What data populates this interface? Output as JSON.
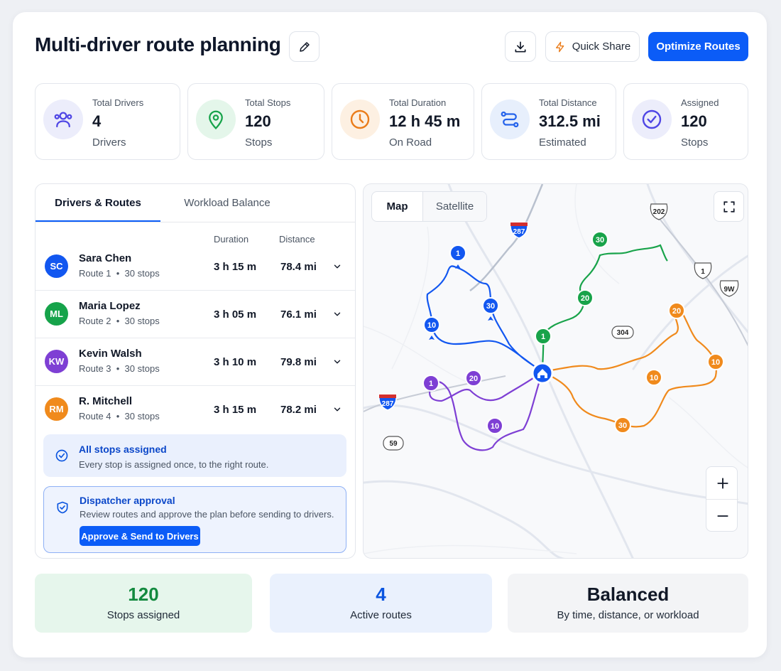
{
  "header": {
    "title": "Multi-driver route planning",
    "quick_share_label": "Quick Share",
    "optimize_label": "Optimize Routes"
  },
  "stats": [
    {
      "label": "Total Drivers",
      "value": "4",
      "sub": "Drivers",
      "icon": "drivers-icon",
      "color": "#4f46e5"
    },
    {
      "label": "Total Stops",
      "value": "120",
      "sub": "Stops",
      "icon": "map-pin-icon",
      "color": "#16a34a"
    },
    {
      "label": "Total Duration",
      "value": "12 h 45 m",
      "sub": "On Road",
      "icon": "clock-icon",
      "color": "#ea7c1a"
    },
    {
      "label": "Total Distance",
      "value": "312.5 mi",
      "sub": "Estimated",
      "icon": "route-icon",
      "color": "#2563eb"
    },
    {
      "label": "Assigned",
      "value": "120",
      "sub": "Stops",
      "icon": "check-circle-icon",
      "color": "#4f46e5"
    }
  ],
  "panel": {
    "tabs": [
      {
        "label": "Drivers & Routes",
        "active": true
      },
      {
        "label": "Workload Balance",
        "active": false
      }
    ],
    "columns": {
      "duration": "Duration",
      "distance": "Distance"
    },
    "drivers": [
      {
        "initials": "SC",
        "name": "Sara Chen",
        "route": "Route 1",
        "stops": "30 stops",
        "duration": "3 h 15 m",
        "distance": "78.4 mi",
        "color": "#1257f0"
      },
      {
        "initials": "ML",
        "name": "Maria Lopez",
        "route": "Route 2",
        "stops": "30 stops",
        "duration": "3 h 05 m",
        "distance": "76.1 mi",
        "color": "#16a34a"
      },
      {
        "initials": "KW",
        "name": "Kevin Walsh",
        "route": "Route 3",
        "stops": "30 stops",
        "duration": "3 h 10 m",
        "distance": "79.8 mi",
        "color": "#7e3fd4"
      },
      {
        "initials": "RM",
        "name": "R. Mitchell",
        "route": "Route 4",
        "stops": "30 stops",
        "duration": "3 h 15 m",
        "distance": "78.2 mi",
        "color": "#f08a1c"
      }
    ],
    "assigned_notice": {
      "title": "All stops assigned",
      "text": "Every stop is assigned once, to the right route."
    },
    "approval": {
      "title": "Dispatcher approval",
      "text": "Review routes and approve the plan before sending to drivers.",
      "button": "Approve & Send to Drivers"
    }
  },
  "map": {
    "modes": [
      {
        "label": "Map",
        "active": true
      },
      {
        "label": "Satellite",
        "active": false
      }
    ],
    "road_shields": [
      "202",
      "287",
      "1",
      "9W",
      "304",
      "287",
      "59"
    ],
    "markers": {
      "blue": [
        "1",
        "30",
        "10"
      ],
      "green": [
        "30",
        "20",
        "1"
      ],
      "purple": [
        "1",
        "20",
        "10"
      ],
      "orange": [
        "20",
        "10",
        "10",
        "20"
      ]
    },
    "extra_markers": {
      "orange_bottom": "30"
    }
  },
  "summary": [
    {
      "value": "120",
      "label": "Stops assigned",
      "bg": "#e6f6ec",
      "color": "#138a3f"
    },
    {
      "value": "4",
      "label": "Active routes",
      "bg": "#eaf1fd",
      "color": "#0b55e0"
    },
    {
      "value": "Balanced",
      "label": "By time, distance, or workload",
      "bg": "#f3f4f6",
      "color": "#111827"
    }
  ]
}
